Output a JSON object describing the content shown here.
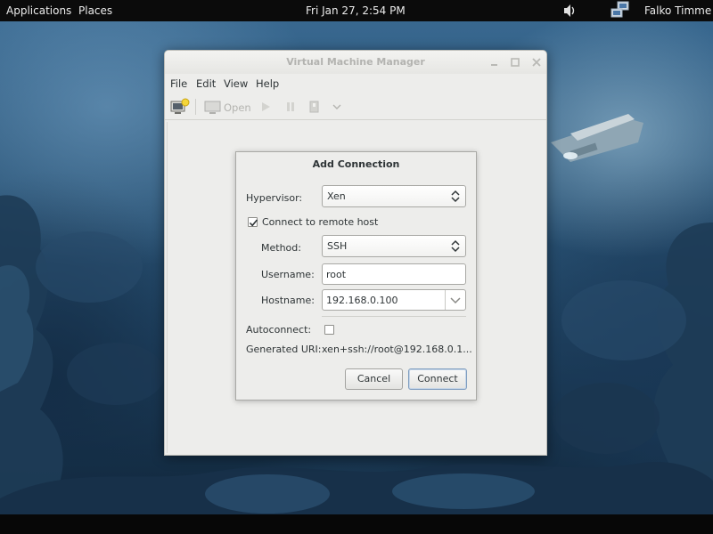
{
  "topbar": {
    "applications": "Applications",
    "places": "Places",
    "clock": "Fri Jan 27,  2:54 PM",
    "user": "Falko Timme"
  },
  "window": {
    "title": "Virtual Machine Manager",
    "menu": [
      "File",
      "Edit",
      "View",
      "Help"
    ],
    "toolbar": {
      "open_label": "Open"
    }
  },
  "dialog": {
    "title": "Add Connection",
    "hypervisor_label": "Hypervisor:",
    "hypervisor_value": "Xen",
    "remote_label": "Connect to remote host",
    "remote_checked": true,
    "method_label": "Method:",
    "method_value": "SSH",
    "username_label": "Username:",
    "username_value": "root",
    "hostname_label": "Hostname:",
    "hostname_value": "192.168.0.100",
    "autoconnect_label": "Autoconnect:",
    "autoconnect_checked": false,
    "uri_label": "Generated URI:",
    "uri_value": "xen+ssh://root@192.168.0.1...",
    "cancel_label": "Cancel",
    "connect_label": "Connect"
  },
  "colors": {
    "topbar_bg": "#0b0b0b",
    "window_bg": "#ededeb",
    "default_button_border": "#7d9cbf"
  },
  "icons": [
    "volume-icon",
    "network-icon",
    "new-connection-icon",
    "monitor-icon",
    "play-icon",
    "pause-icon",
    "shutdown-icon",
    "chevron-down-icon",
    "minimize-icon",
    "maximize-icon",
    "close-icon",
    "updown-arrows-icon",
    "checkmark-icon"
  ]
}
